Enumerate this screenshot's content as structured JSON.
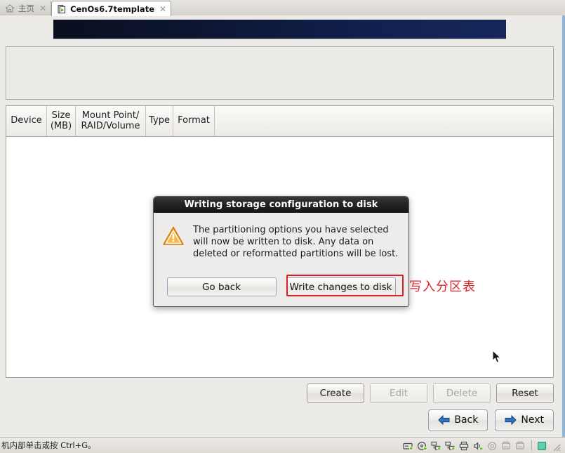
{
  "window": {
    "tabs": [
      {
        "label": "主页",
        "icon": "home-icon",
        "active": false,
        "close": "✕"
      },
      {
        "label": "CenOs6.7template",
        "icon": "vm-icon",
        "active": true,
        "close": "✕"
      }
    ]
  },
  "installer": {
    "table": {
      "headers": [
        "Device",
        "Size\n(MB)",
        "Mount Point/\nRAID/Volume",
        "Type",
        "Format"
      ],
      "header_device": "Device",
      "header_size_line1": "Size",
      "header_size_line2": "(MB)",
      "header_mount_line1": "Mount Point/",
      "header_mount_line2": "RAID/Volume",
      "header_type": "Type",
      "header_format": "Format",
      "rows": []
    },
    "actions": [
      {
        "label": "Create",
        "enabled": true
      },
      {
        "label": "Edit",
        "enabled": false
      },
      {
        "label": "Delete",
        "enabled": false
      },
      {
        "label": "Reset",
        "enabled": true
      }
    ],
    "navigation": [
      {
        "label": "Back",
        "icon": "arrow-left-icon"
      },
      {
        "label": "Next",
        "icon": "arrow-right-icon"
      }
    ]
  },
  "dialog": {
    "title": "Writing storage configuration to disk",
    "icon": "warning-triangle-icon",
    "message_line1": "The partitioning options you have selected",
    "message_line2": "will now be written to disk.  Any data on",
    "message_line3": "deleted or reformatted partitions will be lost.",
    "buttons": [
      {
        "label": "Go back",
        "highlighted": false
      },
      {
        "label": "Write changes to disk",
        "highlighted": true
      }
    ]
  },
  "annotation": {
    "text": "写入分区表",
    "color": "#e0252c"
  },
  "statusbar": {
    "text": "机内部单击或按 Ctrl+G。",
    "icons": [
      "hard-disk-icon",
      "cd-dvd-icon",
      "network-adapter-icon",
      "network-adapter-2-icon",
      "printer-icon",
      "sound-card-icon",
      "camera-icon",
      "usb-device-icon",
      "usb-device-2-icon",
      "display-icon"
    ]
  },
  "colors": {
    "accent_blue": "#1a4f9c",
    "annotation_red": "#e0252c",
    "warning_orange": "#f0a030",
    "banner_navy": "#11204e"
  }
}
